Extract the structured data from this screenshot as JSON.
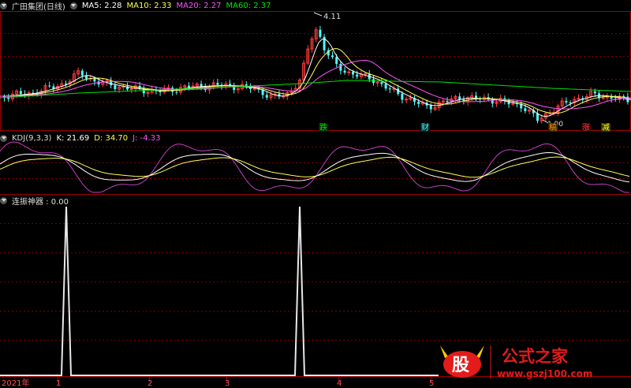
{
  "colors": {
    "up": "#ff3c3c",
    "down": "#54fcfc",
    "white": "#ffffff",
    "yellow": "#ffff54",
    "magenta": "#ff54ff",
    "green": "#00e600",
    "purple": "#c040c0",
    "grid": "#7a0000"
  },
  "main_panel": {
    "title": "广田集团(日线)",
    "ma": [
      {
        "label": "MA5: 2.28",
        "color": "#ffffff"
      },
      {
        "label": "MA10: 2.33",
        "color": "#ffff54"
      },
      {
        "label": "MA20: 2.27",
        "color": "#ff54ff"
      },
      {
        "label": "MA60: 2.37",
        "color": "#00e600"
      }
    ],
    "high_label": "4.11",
    "low_label": "1.90",
    "markers": [
      {
        "text": "跌",
        "color": "#00e600"
      },
      {
        "text": "财",
        "color": "#54fcfc"
      },
      {
        "text": "稿",
        "color": "#ff9900"
      },
      {
        "text": "涨",
        "color": "#ff3c3c"
      },
      {
        "text": "减",
        "color": "#ffff00"
      }
    ]
  },
  "kdj_panel": {
    "title": "KDJ(9,3,3)",
    "k": "K: 21.69",
    "d": "D: 34.70",
    "j": "J: -4.33",
    "k_color": "#ffffff",
    "d_color": "#ffff54",
    "j_color": "#ff54ff"
  },
  "osc_panel": {
    "title": "连振神器 : 0.00"
  },
  "x_axis": {
    "labels": [
      "2021年",
      "1",
      "2",
      "3",
      "4",
      "5"
    ]
  },
  "watermark": {
    "glyph": "股",
    "title": "公式之家",
    "url": "www.gszj100.com"
  },
  "chart_data": [
    {
      "type": "candlestick",
      "title": "广田集团(日线)",
      "series": [
        {
          "name": "MA5",
          "last": 2.28
        },
        {
          "name": "MA10",
          "last": 2.33
        },
        {
          "name": "MA20",
          "last": 2.27
        },
        {
          "name": "MA60",
          "last": 2.37
        }
      ],
      "annotations": [
        {
          "text": "4.11",
          "kind": "high"
        },
        {
          "text": "1.90",
          "kind": "low"
        }
      ]
    },
    {
      "type": "line",
      "title": "KDJ(9,3,3)",
      "series": [
        {
          "name": "K",
          "last": 21.69
        },
        {
          "name": "D",
          "last": 34.7
        },
        {
          "name": "J",
          "last": -4.33
        }
      ]
    },
    {
      "type": "line",
      "title": "连振神器",
      "series": [
        {
          "name": "连振神器",
          "last": 0.0
        }
      ],
      "spikes": 2
    }
  ]
}
